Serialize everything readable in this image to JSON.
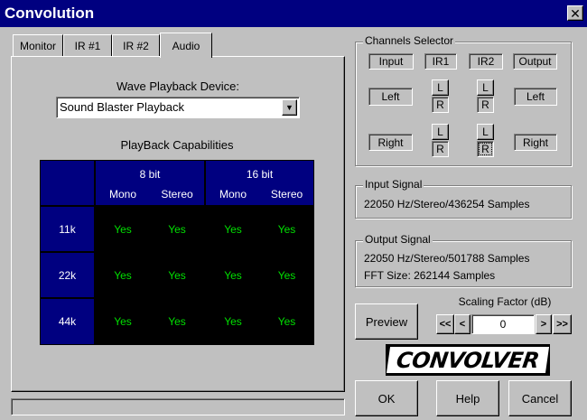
{
  "window": {
    "title": "Convolution",
    "close_glyph": "✕"
  },
  "tabs": [
    {
      "label": "Monitor"
    },
    {
      "label": "IR #1"
    },
    {
      "label": "IR #2"
    },
    {
      "label": "Audio",
      "active": true
    }
  ],
  "audio": {
    "device_label": "Wave Playback Device:",
    "device_value": "Sound Blaster Playback",
    "capabilities_title": "PlayBack Capabilities",
    "groups": [
      "8 bit",
      "16 bit"
    ],
    "sub_headers": [
      "Mono",
      "Stereo",
      "Mono",
      "Stereo"
    ],
    "rows": [
      {
        "rate": "11k",
        "values": [
          "Yes",
          "Yes",
          "Yes",
          "Yes"
        ]
      },
      {
        "rate": "22k",
        "values": [
          "Yes",
          "Yes",
          "Yes",
          "Yes"
        ]
      },
      {
        "rate": "44k",
        "values": [
          "Yes",
          "Yes",
          "Yes",
          "Yes"
        ]
      }
    ]
  },
  "channels": {
    "title": "Channels Selector",
    "headers": [
      "Input",
      "IR1",
      "IR2",
      "Output"
    ],
    "left_label": "Left",
    "right_label": "Right",
    "l": "L",
    "r": "R"
  },
  "input_signal": {
    "title": "Input Signal",
    "line1": "22050 Hz/Stereo/436254 Samples"
  },
  "output_signal": {
    "title": "Output Signal",
    "line1": "22050 Hz/Stereo/501788 Samples",
    "line2": "FFT Size: 262144 Samples"
  },
  "scaling": {
    "title": "Scaling Factor (dB)",
    "value": "0",
    "first": "<<",
    "prev": "<",
    "next": ">",
    "last": ">>"
  },
  "buttons": {
    "preview": "Preview",
    "ok": "OK",
    "help": "Help",
    "cancel": "Cancel"
  },
  "logo": {
    "text": "CONVOLVER"
  },
  "colors": {
    "title_bar": "#000080",
    "grid_header": "#000080",
    "yes_text": "#00e000",
    "face": "#c0c0c0"
  }
}
